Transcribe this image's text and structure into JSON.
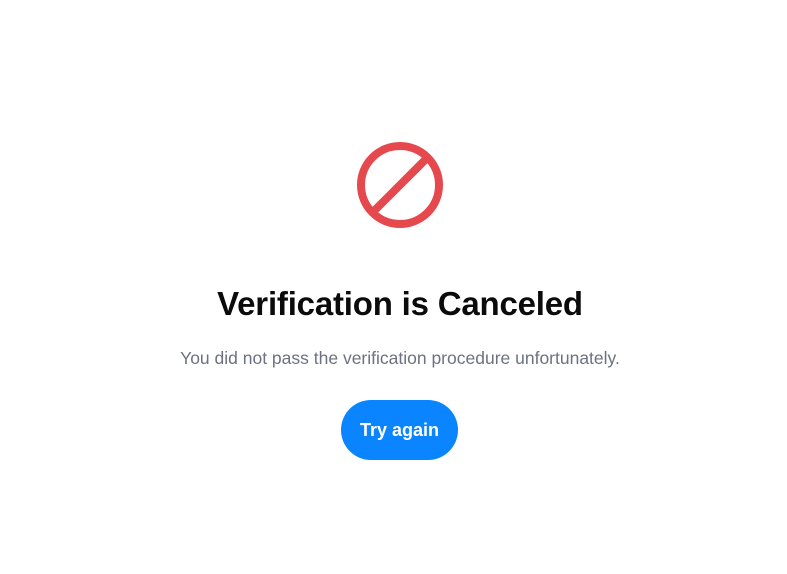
{
  "status": {
    "icon": "prohibited-icon",
    "icon_color": "#e5484d",
    "title": "Verification is Canceled",
    "message": "You did not pass the verification procedure unfortunately."
  },
  "actions": {
    "retry_label": "Try again",
    "retry_color": "#0a85ff"
  }
}
